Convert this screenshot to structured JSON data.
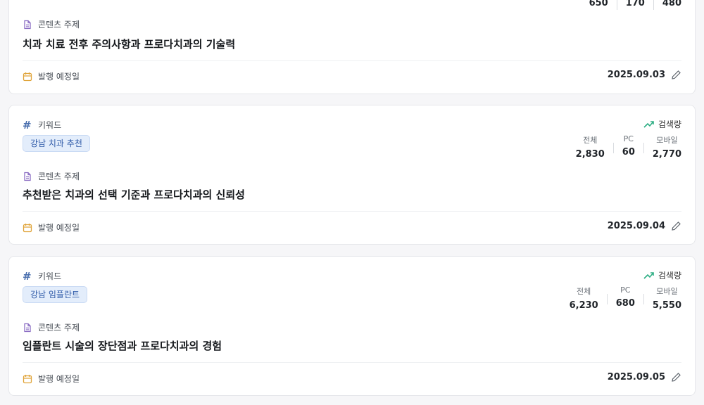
{
  "labels": {
    "keyword": "키워드",
    "topic": "콘텐츠 주제",
    "publish": "발행 예정일",
    "volume": "검색량",
    "total": "전체",
    "pc": "PC",
    "mobile": "모바일"
  },
  "colors": {
    "tag_bg": "#e3edfb",
    "tag_text": "#2f5aa8",
    "topic_icon": "#8a6cc2",
    "calendar_icon": "#e0a43a",
    "trend_icon": "#2eae84"
  },
  "cards": [
    {
      "stats": {
        "total": "650",
        "pc": "170",
        "mobile": "480"
      },
      "topic": "치과 치료 전후 주의사항과 프로다치과의 기술력",
      "date": "2025.09.03"
    },
    {
      "keyword": "강남 치과 추천",
      "stats": {
        "total": "2,830",
        "pc": "60",
        "mobile": "2,770"
      },
      "topic": "추천받은 치과의 선택 기준과 프로다치과의 신뢰성",
      "date": "2025.09.04"
    },
    {
      "keyword": "강남 임플란트",
      "stats": {
        "total": "6,230",
        "pc": "680",
        "mobile": "5,550"
      },
      "topic": "임플란트 시술의 장단점과 프로다치과의 경험",
      "date": "2025.09.05"
    }
  ]
}
